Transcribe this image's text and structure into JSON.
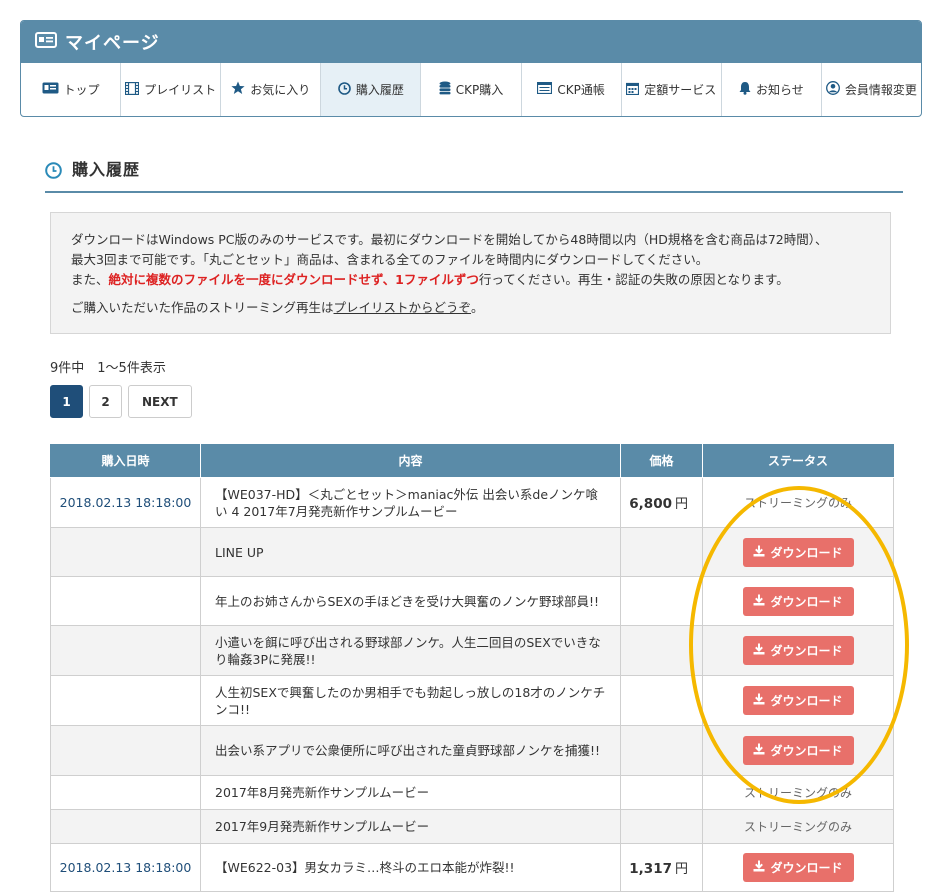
{
  "header": {
    "title": "マイページ",
    "nav": [
      {
        "label": "トップ",
        "icon": "id-card-icon"
      },
      {
        "label": "プレイリスト",
        "icon": "film-icon"
      },
      {
        "label": "お気に入り",
        "icon": "star-icon"
      },
      {
        "label": "購入履歴",
        "icon": "clock-icon",
        "active": true
      },
      {
        "label": "CKP購入",
        "icon": "coins-icon"
      },
      {
        "label": "CKP通帳",
        "icon": "passbook-icon"
      },
      {
        "label": "定額サービス",
        "icon": "calendar-icon"
      },
      {
        "label": "お知らせ",
        "icon": "bell-icon"
      },
      {
        "label": "会員情報変更",
        "icon": "user-icon"
      }
    ]
  },
  "section": {
    "title": "購入履歴"
  },
  "notice": {
    "line1": "ダウンロードはWindows PC版のみのサービスです。最初にダウンロードを開始してから48時間以内（HD規格を含む商品は72時間）、",
    "line2": "最大3回まで可能です。「丸ごとセット」商品は、含まれる全てのファイルを時間内にダウンロードしてください。",
    "line3_pre": "また、",
    "line3_red": "絶対に複数のファイルを一度にダウンロードせず、1ファイルずつ",
    "line3_post": "行ってください。再生・認証の失敗の原因となります。",
    "line4_pre": "ご購入いただいた作品のストリーミング再生は",
    "line4_link": "プレイリストからどうぞ",
    "line4_post": "。"
  },
  "pagination": {
    "summary": "9件中　1〜5件表示",
    "pages": [
      "1",
      "2"
    ],
    "current": "1",
    "next": "NEXT"
  },
  "table": {
    "headers": [
      "購入日時",
      "内容",
      "価格",
      "ステータス"
    ],
    "download_label": "ダウンロード",
    "rows": [
      {
        "date": "2018.02.13 18:18:00",
        "content": "【WE037-HD】＜丸ごとセット＞maniac外伝 出会い系deノンケ喰い 4 2017年7月発売新作サンプルムービー",
        "price": "6,800",
        "unit": "円",
        "status": "ストリーミングのみ"
      },
      {
        "date": "",
        "content": "LINE UP",
        "price": "",
        "unit": "",
        "status": "download"
      },
      {
        "date": "",
        "content": "年上のお姉さんからSEXの手ほどきを受け大興奮のノンケ野球部員!!",
        "price": "",
        "unit": "",
        "status": "download"
      },
      {
        "date": "",
        "content": "小遣いを餌に呼び出される野球部ノンケ。人生二回目のSEXでいきなり輪姦3Pに発展!!",
        "price": "",
        "unit": "",
        "status": "download"
      },
      {
        "date": "",
        "content": "人生初SEXで興奮したのか男相手でも勃起しっ放しの18才のノンケチンコ!!",
        "price": "",
        "unit": "",
        "status": "download"
      },
      {
        "date": "",
        "content": "出会い系アプリで公衆便所に呼び出された童貞野球部ノンケを捕獲!!",
        "price": "",
        "unit": "",
        "status": "download"
      },
      {
        "date": "",
        "content": "2017年8月発売新作サンプルムービー",
        "price": "",
        "unit": "",
        "status": "ストリーミングのみ"
      },
      {
        "date": "",
        "content": "2017年9月発売新作サンプルムービー",
        "price": "",
        "unit": "",
        "status": "ストリーミングのみ"
      },
      {
        "date": "2018.02.13 18:18:00",
        "content": "【WE622-03】男女カラミ…柊斗のエロ本能が炸裂!!",
        "price": "1,317",
        "unit": "円",
        "status": "download"
      }
    ]
  },
  "colors": {
    "header_bg": "#5a8ba8",
    "download_button": "#e8706a",
    "highlight": "#f5b800",
    "page_current": "#1f4e79",
    "notice_red": "#dd2222"
  }
}
